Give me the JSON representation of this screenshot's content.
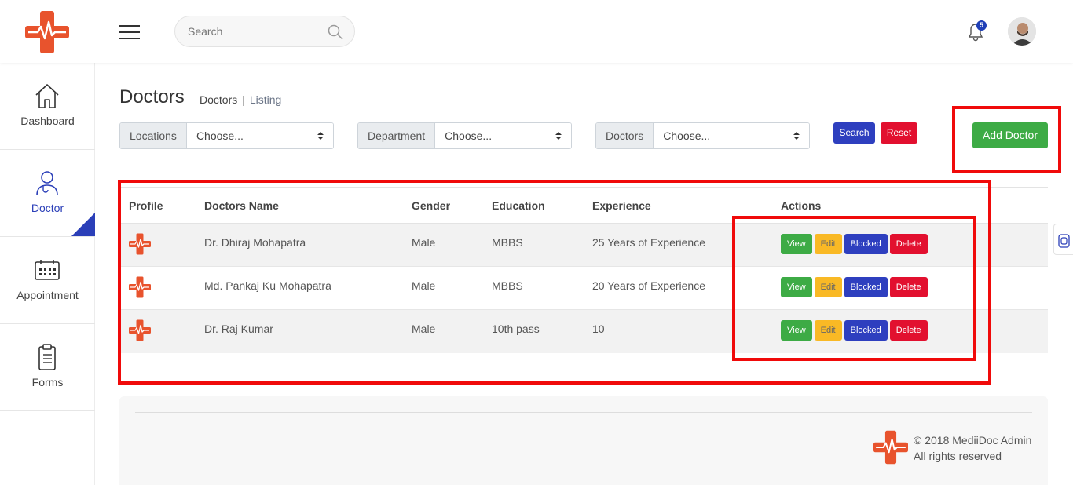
{
  "header": {
    "search_placeholder": "Search",
    "notification_count": "5",
    "icons": {
      "menu": "hamburger-icon",
      "search": "search-icon",
      "bell": "bell-icon"
    }
  },
  "sidebar": {
    "items": [
      {
        "label": "Dashboard",
        "icon": "home-icon",
        "active": false
      },
      {
        "label": "Doctor",
        "icon": "doctor-icon",
        "active": true
      },
      {
        "label": "Appointment",
        "icon": "calendar-icon",
        "active": false
      },
      {
        "label": "Forms",
        "icon": "clipboard-icon",
        "active": false
      }
    ]
  },
  "page": {
    "title": "Doctors",
    "breadcrumb": [
      "Doctors",
      "|",
      "Listing"
    ]
  },
  "filters": [
    {
      "label": "Locations",
      "value": "Choose..."
    },
    {
      "label": "Department",
      "value": "Choose..."
    },
    {
      "label": "Doctors",
      "value": "Choose..."
    }
  ],
  "buttons": {
    "search": "Search",
    "reset": "Reset",
    "add": "Add Doctor"
  },
  "table": {
    "headers": [
      "Profile",
      "Doctors Name",
      "Gender",
      "Education",
      "Experience",
      "Actions"
    ],
    "rows": [
      {
        "name": "Dr. Dhiraj Mohapatra",
        "gender": "Male",
        "education": "MBBS",
        "experience": "25 Years of Experience"
      },
      {
        "name": "Md. Pankaj Ku Mohapatra",
        "gender": "Male",
        "education": "MBBS",
        "experience": "20 Years of Experience"
      },
      {
        "name": "Dr. Raj Kumar",
        "gender": "Male",
        "education": "10th pass",
        "experience": "10"
      }
    ],
    "actions": {
      "view": "View",
      "edit": "Edit",
      "blocked": "Blocked",
      "delete": "Delete"
    }
  },
  "footer": {
    "copyright": "© 2018 MediiDoc Admin",
    "rights": "All rights reserved"
  },
  "colors": {
    "brand": "#e8532d",
    "primary": "#2e3fbf",
    "success": "#3dab45",
    "warning": "#f9b925",
    "danger": "#e2102f",
    "highlight": "#f00a0a"
  }
}
